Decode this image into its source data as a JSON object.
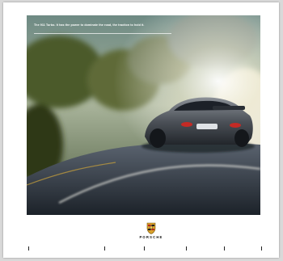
{
  "document": {
    "headline": "The 911 Turbo. It has the power to dominate the road, the traction to hold it.",
    "subheadline": "",
    "date": ""
  },
  "brand": {
    "crest_icon": "porsche-crest-icon",
    "wordmark": "PORSCHE"
  },
  "footer": {
    "marks": [
      "",
      "",
      "",
      "",
      "",
      ""
    ]
  },
  "colors": {
    "crest_gold": "#d9a22b",
    "crest_red": "#b8261f"
  }
}
